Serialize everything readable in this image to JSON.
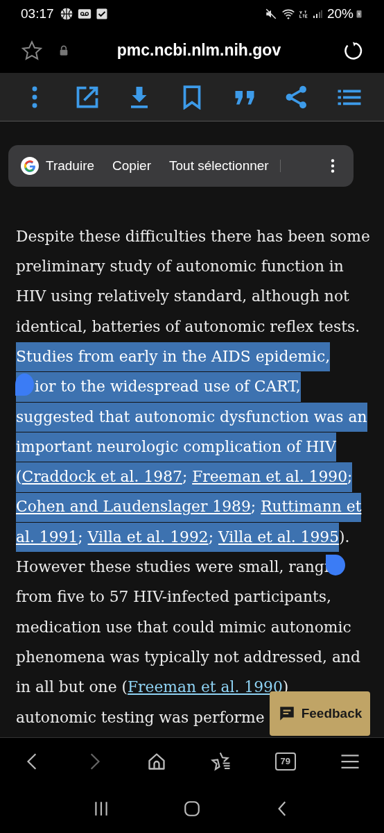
{
  "status_bar": {
    "time": "03:17",
    "battery": "20%"
  },
  "address_bar": {
    "url": "pmc.ncbi.nlm.nih.gov"
  },
  "selection_menu": {
    "items": [
      "Traduire",
      "Copier",
      "Tout sélectionner"
    ]
  },
  "article": {
    "lines": [
      {
        "parts": [
          {
            "kind": "text",
            "selected": false,
            "text": "Despite these difficulties there has been some"
          }
        ]
      },
      {
        "parts": [
          {
            "kind": "text",
            "selected": false,
            "text": "preliminary study of autonomic function in"
          }
        ]
      },
      {
        "parts": [
          {
            "kind": "text",
            "selected": false,
            "text": "HIV using relatively standard, although not"
          }
        ]
      },
      {
        "parts": [
          {
            "kind": "text",
            "selected": false,
            "text": "identical, batteries of autonomic reflex tests."
          }
        ]
      },
      {
        "parts": [
          {
            "kind": "text",
            "selected": true,
            "text": "Studies from early in the AIDS epidemic,"
          }
        ]
      },
      {
        "parts": [
          {
            "kind": "text",
            "selected": true,
            "text": "ior to the widespread use of CART,"
          }
        ]
      },
      {
        "parts": [
          {
            "kind": "text",
            "selected": true,
            "text": "suggested that autonomic dysfunction was an"
          }
        ]
      },
      {
        "parts": [
          {
            "kind": "text",
            "selected": true,
            "text": "important neurologic complication of HIV"
          }
        ]
      },
      {
        "parts": [
          {
            "kind": "text",
            "selected": true,
            "text": "("
          },
          {
            "kind": "link",
            "selected": true,
            "text": "Craddock et al. 1987"
          },
          {
            "kind": "text",
            "selected": true,
            "text": "; "
          },
          {
            "kind": "link",
            "selected": true,
            "text": "Freeman et al. 1990"
          },
          {
            "kind": "text",
            "selected": true,
            "text": ";"
          }
        ]
      },
      {
        "parts": [
          {
            "kind": "link",
            "selected": true,
            "text": "Cohen and Laudenslager 1989"
          },
          {
            "kind": "text",
            "selected": true,
            "text": "; "
          },
          {
            "kind": "link",
            "selected": true,
            "text": "Ruttimann et"
          }
        ]
      },
      {
        "parts": [
          {
            "kind": "link",
            "selected": true,
            "text": "al. 1991"
          },
          {
            "kind": "text",
            "selected": true,
            "text": "; "
          },
          {
            "kind": "link",
            "selected": true,
            "text": "Villa et al. 1992"
          },
          {
            "kind": "text",
            "selected": true,
            "text": "; "
          },
          {
            "kind": "link",
            "selected": true,
            "text": "Villa et al. 1995"
          },
          {
            "kind": "text",
            "selected": false,
            "text": ")."
          }
        ]
      },
      {
        "parts": [
          {
            "kind": "text",
            "selected": false,
            "text": "However these studies were small, rangi"
          }
        ]
      },
      {
        "parts": [
          {
            "kind": "text",
            "selected": false,
            "text": "from five to 57 HIV-infected participants,"
          }
        ]
      },
      {
        "parts": [
          {
            "kind": "text",
            "selected": false,
            "text": "medication use that could mimic autonomic"
          }
        ]
      },
      {
        "parts": [
          {
            "kind": "text",
            "selected": false,
            "text": "phenomena was typically not addressed, and"
          }
        ]
      },
      {
        "parts": [
          {
            "kind": "text",
            "selected": false,
            "text": "in all but one ("
          },
          {
            "kind": "link",
            "selected": false,
            "text": "Freeman et al. 1990"
          },
          {
            "kind": "text",
            "selected": false,
            "text": ")"
          }
        ]
      },
      {
        "parts": [
          {
            "kind": "text",
            "selected": false,
            "text": "autonomic testing was performe"
          }
        ]
      }
    ]
  },
  "feedback_button": {
    "label": "Feedback"
  },
  "bottom_bar": {
    "tab_count": "79"
  }
}
